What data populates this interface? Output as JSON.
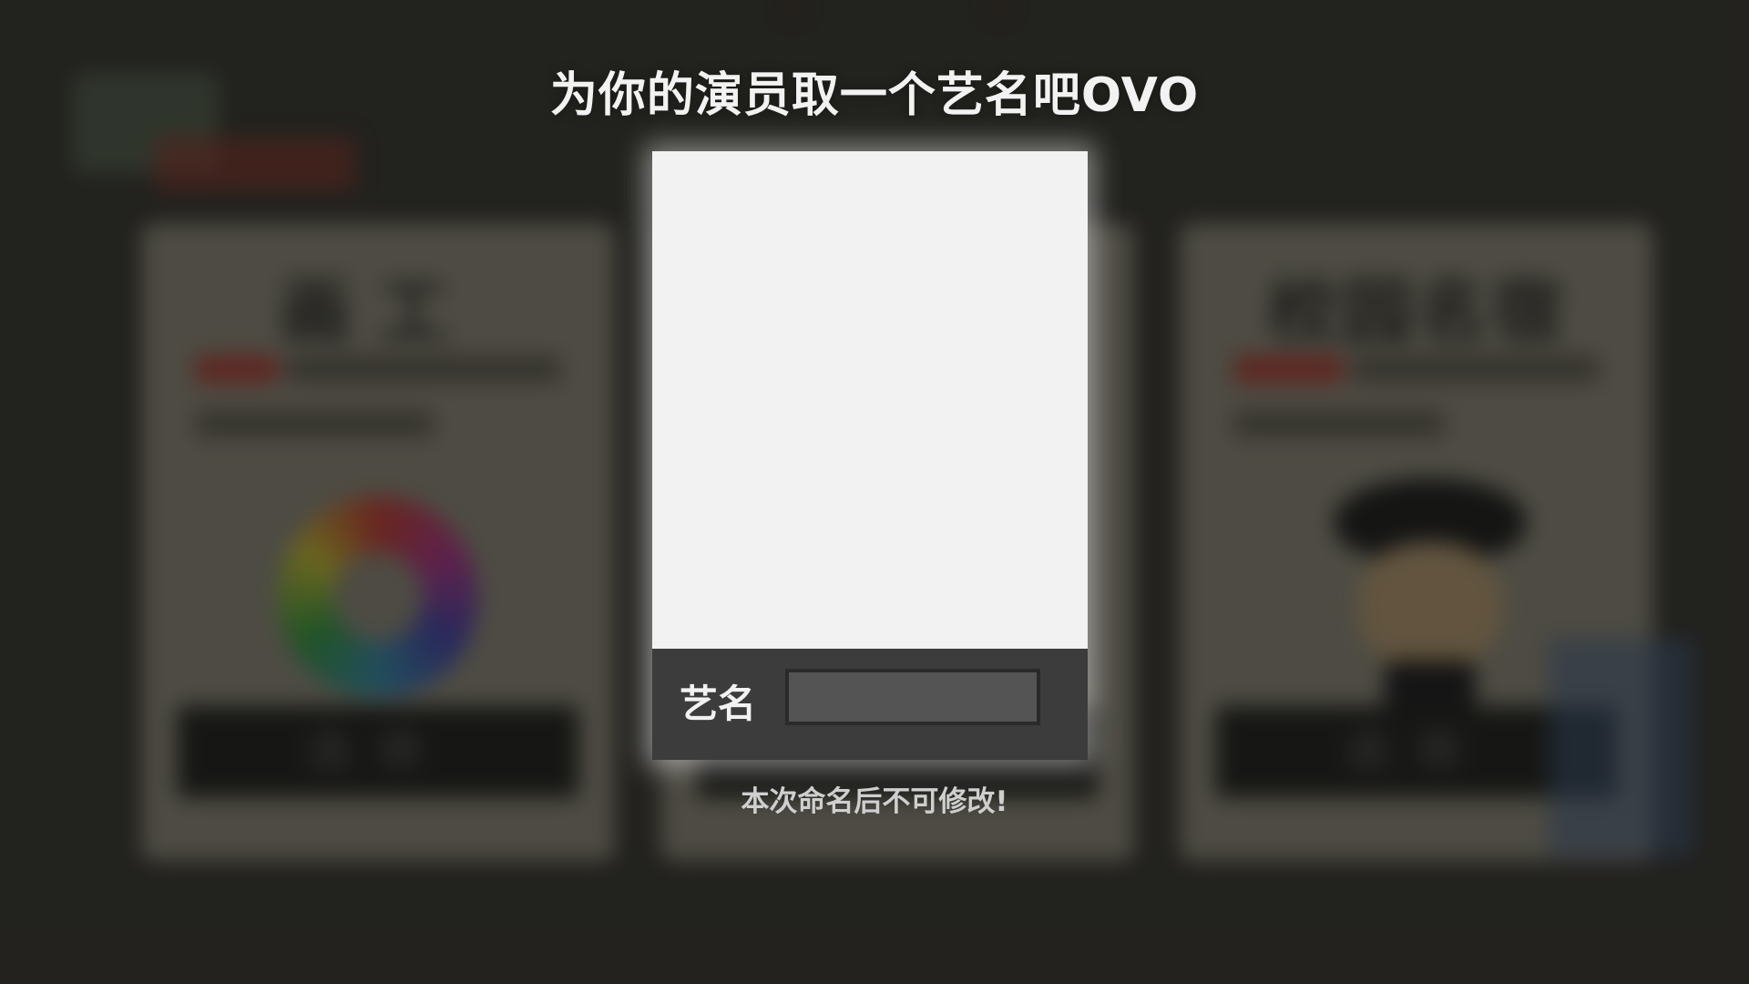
{
  "modal": {
    "title": "为你的演员取一个艺名吧OVO",
    "name_label": "艺名",
    "name_input_value": "",
    "name_input_placeholder": "",
    "warning": "本次命名后不可修改!",
    "portrait_color": "#f2f2f2",
    "name_bar_color": "#3c3c3c"
  },
  "background": {
    "cards": [
      {
        "heading": "画工",
        "action": "选择",
        "illustration": "color-wheel"
      },
      {
        "heading": "",
        "action": "",
        "illustration": ""
      },
      {
        "heading": "校园名宿",
        "action": "选择",
        "illustration": "graduate-character"
      }
    ],
    "overlay_color": "#2b2a27"
  }
}
